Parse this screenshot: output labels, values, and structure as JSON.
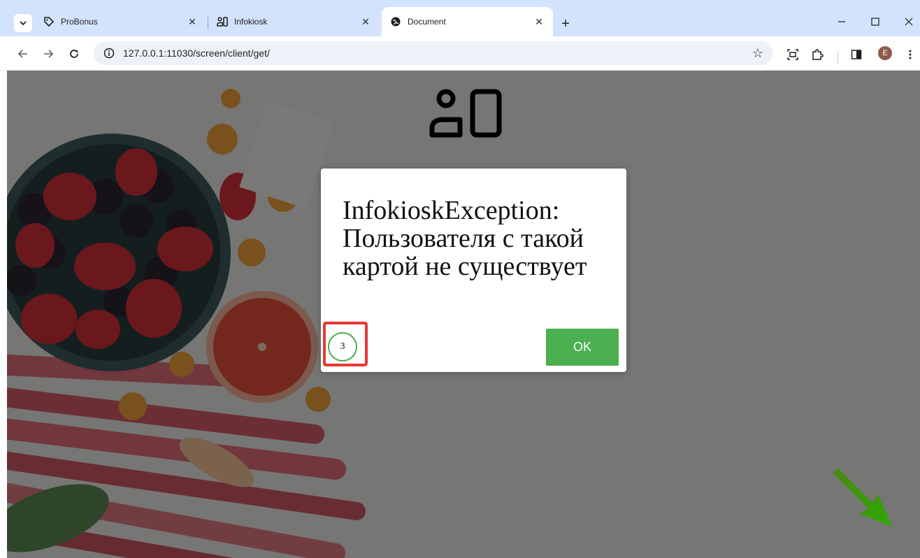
{
  "browser": {
    "tabs": [
      {
        "title": "ProBonus",
        "active": false,
        "icon": "tag-icon"
      },
      {
        "title": "Infokiosk",
        "active": false,
        "icon": "kiosk-logo-icon"
      },
      {
        "title": "Document",
        "active": true,
        "icon": "globe-icon"
      }
    ],
    "url": "127.0.0.1:11030/screen/client/get/",
    "profile_initial": "E"
  },
  "dialog": {
    "message": "InfokioskException: Пользователя с такой картой не существует",
    "countdown": "3",
    "ok_label": "OK"
  },
  "colors": {
    "tabbar": "#d3e3fd",
    "ok_button": "#4caf50",
    "countdown_ring": "#4caf50",
    "highlight": "#e53935",
    "arrow": "#3a9a08"
  }
}
